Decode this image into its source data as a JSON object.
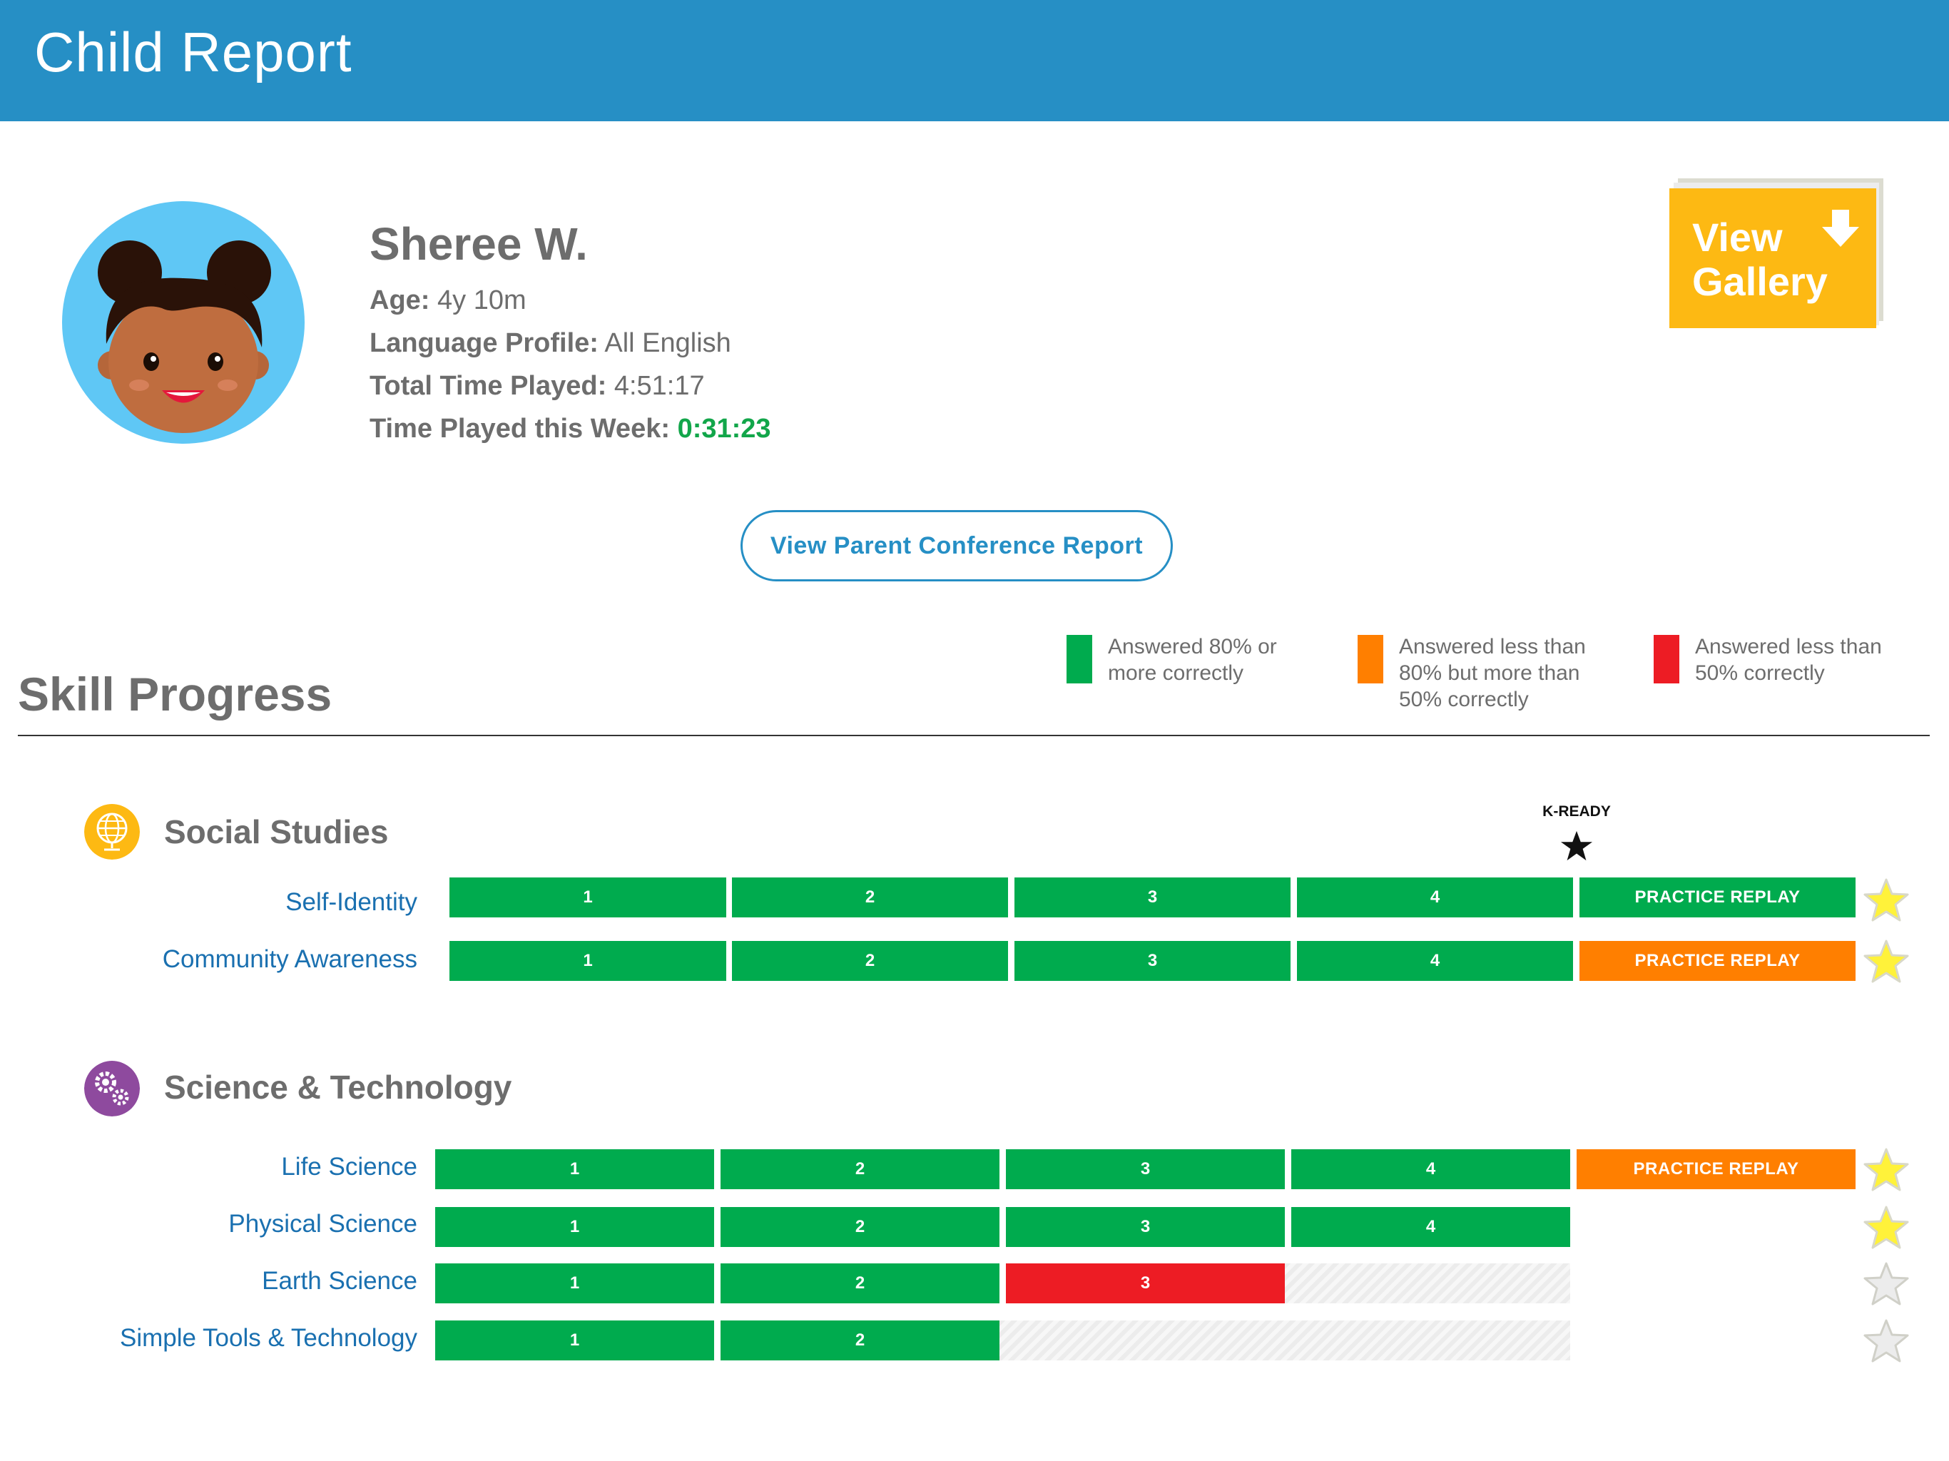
{
  "header": {
    "title": "Child Report"
  },
  "profile": {
    "name": "Sheree W.",
    "age_label": "Age:",
    "age_value": "4y 10m",
    "language_label": "Language Profile:",
    "language_value": "All English",
    "total_label": "Total Time Played:",
    "total_value": "4:51:17",
    "week_label": "Time Played this Week:",
    "week_value": "0:31:23"
  },
  "gallery": {
    "line1": "View",
    "line2": "Gallery"
  },
  "conference_button": "View Parent Conference Report",
  "skill_progress": {
    "title": "Skill Progress",
    "legend": [
      {
        "text": "Answered 80% or more correctly",
        "color": "#00ab4e"
      },
      {
        "text": "Answered less than 80% but more than 50% correctly",
        "color": "#ff7f00"
      },
      {
        "text": "Answered less than 50% correctly",
        "color": "#ed1c24"
      }
    ],
    "kready": "K-READY",
    "sections": [
      {
        "title": "Social Studies",
        "icon": "globe-icon",
        "rows": [
          {
            "label": "Self-Identity",
            "levels": [
              "1",
              "2",
              "3",
              "4"
            ],
            "practice": "PRACTICE REPLAY",
            "practice_status": "green",
            "star": "gold"
          },
          {
            "label": "Community Awareness",
            "levels": [
              "1",
              "2",
              "3",
              "4"
            ],
            "practice": "PRACTICE REPLAY",
            "practice_status": "orange",
            "star": "gold"
          }
        ]
      },
      {
        "title": "Science & Technology",
        "icon": "gears-icon",
        "rows": [
          {
            "label": "Life Science",
            "levels": [
              "1",
              "2",
              "3",
              "4"
            ],
            "practice": "PRACTICE REPLAY",
            "practice_status": "orange",
            "star": "gold"
          },
          {
            "label": "Physical Science",
            "levels": [
              "1",
              "2",
              "3",
              "4"
            ],
            "star": "gold"
          },
          {
            "label": "Earth Science",
            "levels": [
              "1",
              "2",
              "3"
            ],
            "level_status": [
              "green",
              "green",
              "red"
            ],
            "star": "grey"
          },
          {
            "label": "Simple Tools & Technology",
            "levels": [
              "1",
              "2"
            ],
            "star": "grey"
          }
        ]
      }
    ]
  },
  "colors": {
    "header": "#268fc5",
    "green": "#00ab4e",
    "orange": "#ff7f00",
    "red": "#ed1c24",
    "gold": "#fdb913",
    "purple": "#8e4a9e"
  }
}
